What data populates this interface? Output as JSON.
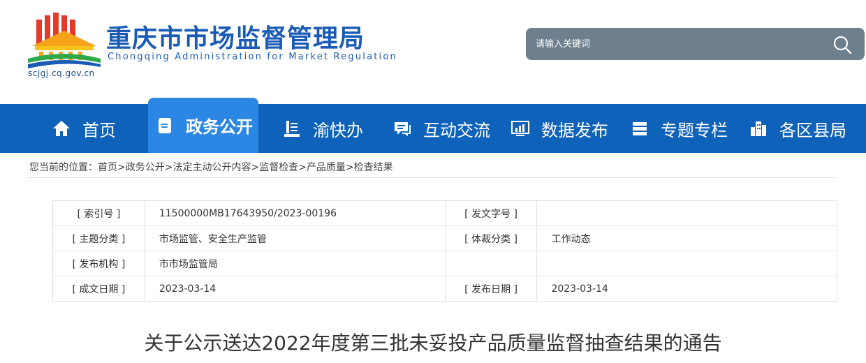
{
  "header": {
    "title": "重庆市市场监督管理局",
    "subtitle": "Chongqing Administration for Market Regulation",
    "domain": "scjgj.cq.gov.cn",
    "logo_icon": "government-building-emblem-icon"
  },
  "search": {
    "placeholder": "请输入关键词",
    "icon": "search-icon"
  },
  "nav": {
    "items": [
      {
        "label": "首页",
        "icon": "home-icon"
      },
      {
        "label": "政务公开",
        "icon": "document-icon",
        "active": true
      },
      {
        "label": "渝快办",
        "icon": "service-hall-icon"
      },
      {
        "label": "互动交流",
        "icon": "chat-icon"
      },
      {
        "label": "数据发布",
        "icon": "data-chart-icon"
      },
      {
        "label": "专题专栏",
        "icon": "column-stack-icon"
      },
      {
        "label": "各区县局",
        "icon": "buildings-icon"
      }
    ]
  },
  "breadcrumb": {
    "prefix": "您当前的位置：",
    "items": [
      "首页",
      "政务公开",
      "法定主动公开内容",
      "监督检查",
      "产品质量",
      "检查结果"
    ],
    "separator": ">"
  },
  "meta": {
    "rows": [
      {
        "label1": "[ 索引号 ]",
        "value1": "11500000MB17643950/2023-00196",
        "label2": "[ 发文字号 ]",
        "value2": ""
      },
      {
        "label1": "[ 主题分类 ]",
        "value1": "市场监管、安全生产监管",
        "label2": "[ 体裁分类 ]",
        "value2": "工作动态"
      },
      {
        "label1": "[ 发布机构 ]",
        "value1": "市市场监管局",
        "label2": "",
        "value2": ""
      },
      {
        "label1": "[ 成文日期 ]",
        "value1": "2023-03-14",
        "label2": "[ 发布日期 ]",
        "value2": "2023-03-14"
      }
    ]
  },
  "document": {
    "title": "关于公示送达2022年度第三批未妥投产品质量监督抽查结果的通告"
  },
  "colors": {
    "nav_bg": "#0f62b9",
    "nav_active": "#2c86e3",
    "brand_blue": "#1a5bb5",
    "search_bg": "#6e7f8e"
  }
}
